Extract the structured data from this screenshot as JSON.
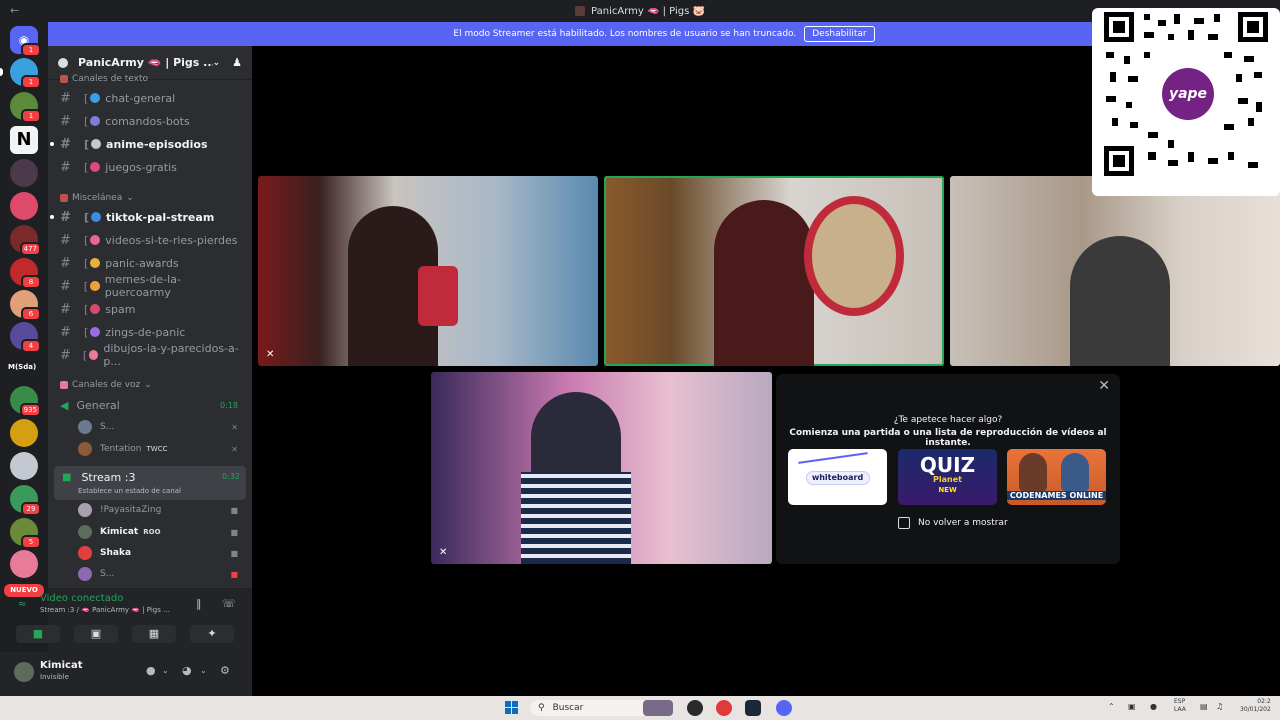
{
  "window": {
    "title": "PanicArmy 🫦 | Pigs 🐷",
    "back_icon": "arrow-left-icon"
  },
  "banner": {
    "text": "El modo Streamer está habilitado. Los nombres de usuario se han truncado.",
    "button": "Deshabilitar"
  },
  "guilds": {
    "badges": [
      "1",
      "1",
      "1",
      "477",
      "8",
      "6",
      "4",
      "935",
      "29",
      "5"
    ],
    "text_server": "M(Sda)",
    "nuevo": "NUEVO"
  },
  "server": {
    "name": "PanicArmy 🫦 | Pigs ...",
    "chevron_icon": "chevron-down-icon",
    "invite_icon": "add-user-icon"
  },
  "categories": {
    "text": "Canales de texto",
    "misc": "Miscelánea",
    "voice": "Canales de voz"
  },
  "text_channels": [
    {
      "name": "chat-general",
      "unread": false,
      "color": "#3aa0e0"
    },
    {
      "name": "comandos-bots",
      "unread": false,
      "color": "#7d7fd6"
    },
    {
      "name": "anime-episodios",
      "unread": true,
      "color": "#c4c8d0"
    },
    {
      "name": "juegos-gratis",
      "unread": false,
      "color": "#e04a7a"
    }
  ],
  "misc_channels": [
    {
      "name": "tiktok-pal-stream",
      "unread": true,
      "color": "#3a8de0"
    },
    {
      "name": "videos-si-te-ries-pierdes",
      "unread": false,
      "color": "#e8679a"
    },
    {
      "name": "panic-awards",
      "unread": false,
      "color": "#e8b13a"
    },
    {
      "name": "memes-de-la-puercoarmy",
      "unread": false,
      "color": "#f0a23a"
    },
    {
      "name": "spam",
      "unread": false,
      "color": "#d64b6b"
    },
    {
      "name": "zings-de-panic",
      "unread": false,
      "color": "#9b6be0"
    },
    {
      "name": "dibujos-ia-y-parecidos-a-p...",
      "unread": false,
      "color": "#e87a9a"
    }
  ],
  "voice": {
    "general": {
      "name": "General",
      "timer": "0:18"
    },
    "general_users": [
      {
        "name": "S...",
        "tag": "",
        "color": "#6b7a8f"
      },
      {
        "name": "Tentation",
        "tag": "TWCC",
        "color": "#8a5a3a"
      }
    ],
    "stream": {
      "name": "Stream :3",
      "timer": "0:32",
      "status": "Establece un estado de canal"
    },
    "stream_users": [
      {
        "name": "!PayasitaZing",
        "tag": "",
        "color": "#a8a0b0",
        "bold": false
      },
      {
        "name": "Kimicat",
        "tag": "ROO",
        "color": "#5d6b5a",
        "bold": true
      },
      {
        "name": "Shaka",
        "tag": "",
        "color": "#e04040",
        "bold": true
      },
      {
        "name": "S...",
        "tag": "",
        "color": "#8a6ab0",
        "bold": false
      }
    ]
  },
  "voice_panel": {
    "title": "Video conectado",
    "subtitle": "Stream :3 / 🫦 PanicArmy 🫦 | Pigs ..."
  },
  "user_panel": {
    "name": "Kimicat",
    "status": "Invisible"
  },
  "activity": {
    "question": "¿Te apetece hacer algo?",
    "subtitle": "Comienza una partida o una lista de reproducción de vídeos al instante.",
    "cards": [
      "whiteboard",
      "QUIZ",
      "CODENAMES ONLINE"
    ],
    "quiz_sub": "Planet",
    "quiz_new": "NEW",
    "checkbox": "No volver a mostrar"
  },
  "overlay": {
    "qr_brand": "yape"
  },
  "taskbar": {
    "search": "Buscar",
    "lang": "ESP",
    "lang2": "LAA",
    "time": "02:2",
    "date": "30/01/202"
  }
}
